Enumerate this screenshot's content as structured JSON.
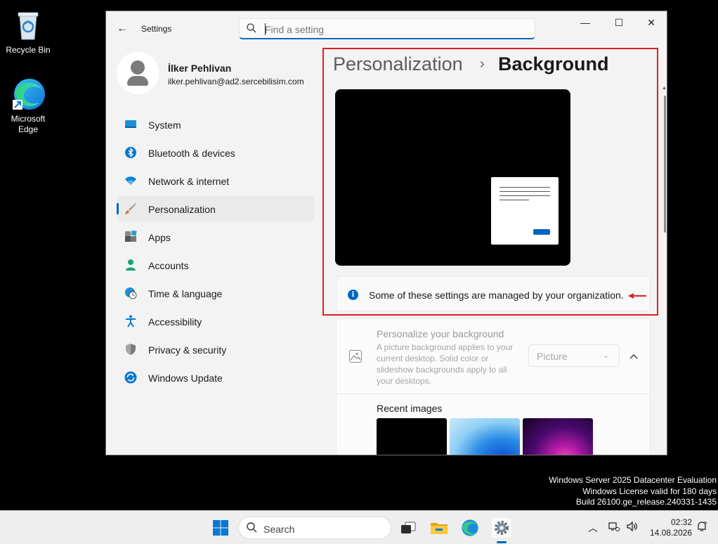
{
  "desktop": {
    "icons": [
      {
        "label": "Recycle Bin",
        "icon": "recycle-bin-icon"
      },
      {
        "label": "Microsoft Edge",
        "icon": "edge-icon"
      }
    ],
    "watermark": {
      "line1": "Windows Server 2025 Datacenter Evaluation",
      "line2": "Windows License valid for 180 days",
      "line3": "Build 26100.ge_release.240331-1435"
    }
  },
  "window": {
    "title": "Settings",
    "search_placeholder": "Find a setting",
    "controls": {
      "minimize": "—",
      "maximize": "☐",
      "close": "✕"
    }
  },
  "profile": {
    "name": "İlker Pehlivan",
    "email": "ilker.pehlivan@ad2.sercebilisim.com"
  },
  "nav": {
    "items": [
      {
        "label": "System",
        "icon": "system-icon",
        "color": "#1d8fd6"
      },
      {
        "label": "Bluetooth & devices",
        "icon": "bluetooth-icon",
        "color": "#0078d4"
      },
      {
        "label": "Network & internet",
        "icon": "wifi-icon",
        "color": "#0a86d8"
      },
      {
        "label": "Personalization",
        "icon": "brush-icon",
        "color": "#e07b1e",
        "active": true
      },
      {
        "label": "Apps",
        "icon": "apps-icon",
        "color": "#555"
      },
      {
        "label": "Accounts",
        "icon": "accounts-icon",
        "color": "#1aa37a"
      },
      {
        "label": "Time & language",
        "icon": "globe-clock-icon",
        "color": "#1d8fd6"
      },
      {
        "label": "Accessibility",
        "icon": "accessibility-icon",
        "color": "#0a78d1"
      },
      {
        "label": "Privacy & security",
        "icon": "shield-icon",
        "color": "#7a7a7a"
      },
      {
        "label": "Windows Update",
        "icon": "update-icon",
        "color": "#0a78d1"
      }
    ]
  },
  "content": {
    "breadcrumb_parent": "Personalization",
    "breadcrumb_separator": "›",
    "breadcrumb_current": "Background",
    "info_message": "Some of these settings are managed by your organization.",
    "background_card": {
      "title": "Personalize your background",
      "description": "A picture background applies to your current desktop. Solid color or slideshow backgrounds apply to all your desktops.",
      "dropdown_value": "Picture"
    },
    "recent_images_label": "Recent images"
  },
  "taskbar": {
    "search_label": "Search",
    "time": "02:32",
    "date": "14.08.2026"
  }
}
